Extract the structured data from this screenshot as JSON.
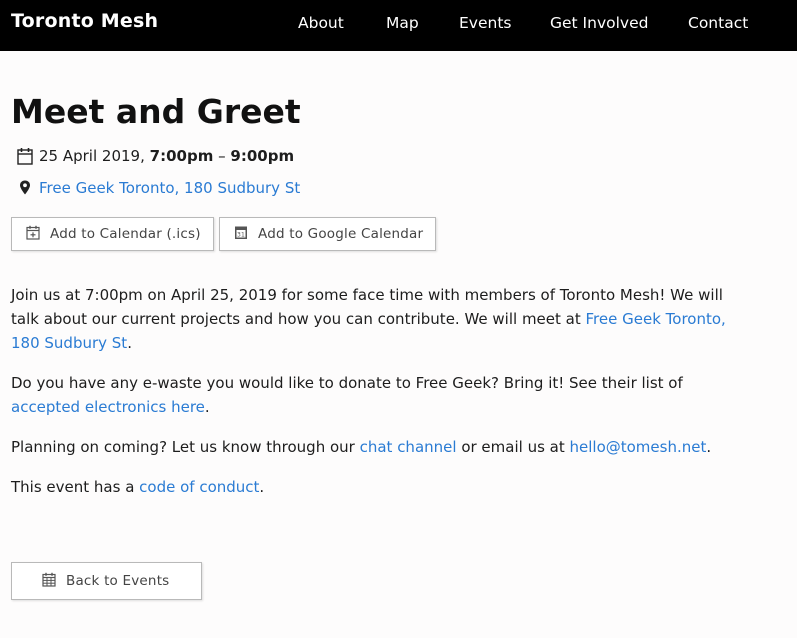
{
  "nav": {
    "brand": "Toronto Mesh",
    "links": [
      "About",
      "Map",
      "Events",
      "Get Involved",
      "Contact"
    ]
  },
  "event": {
    "title": "Meet and Greet",
    "date": "25 April 2019,",
    "start": "7:00pm",
    "dash": "–",
    "end": "9:00pm",
    "location": "Free Geek Toronto, 180 Sudbury St"
  },
  "buttons": {
    "ics": "Add to Calendar (.ics)",
    "google": "Add to Google Calendar",
    "back": "Back to Events"
  },
  "body": {
    "p1_a": "Join us at 7:00pm on April 25, 2019 for some face time with members of Toronto Mesh! We will",
    "p1_b": "talk about our current projects and how you can contribute. We will meet at ",
    "p1_link_a": "Free Geek Toronto,",
    "p1_link_b": "180 Sudbury St",
    "p1_end": ".",
    "p2_a": "Do you have any e-waste you would like to donate to Free Geek? Bring it! See their list of",
    "p2_link": "accepted electronics here",
    "p2_end": ".",
    "p3_a": "Planning on coming? Let us know through our ",
    "p3_link1": "chat channel",
    "p3_mid": " or email us at ",
    "p3_link2": "hello@tomesh.net",
    "p3_end": ".",
    "p4_a": "This event has a ",
    "p4_link": "code of conduct",
    "p4_end": "."
  },
  "colors": {
    "navbar": "#000000",
    "link": "#2a7bd3",
    "background": "#fdfcfc"
  },
  "icons": [
    "calendar-icon",
    "map-pin-icon",
    "calendar-plus-icon",
    "google-calendar-icon",
    "calendar-grid-icon"
  ]
}
